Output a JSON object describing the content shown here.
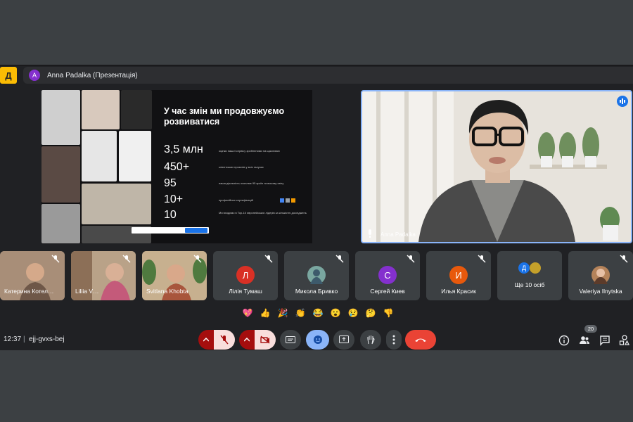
{
  "header": {
    "logo_letter": "Д",
    "presenter_initial": "A",
    "presenter_title": "Anna Padalka (Презентація)"
  },
  "slide": {
    "title": "У час змін ми продовжуємо розвиватися",
    "stats": [
      {
        "value": "3,5 млн",
        "desc": "оцінки нашої сервісу зробленими на щасливих"
      },
      {
        "value": "450+",
        "desc": "клієнтських проєктів у всіх галузях"
      },
      {
        "value": "95",
        "desc": "наша діяльність охоплює 95 країн та всьому світу"
      },
      {
        "value": "10+",
        "desc": "професійних сертифікацій"
      },
      {
        "value": "10",
        "desc": "Ми входимо в Top-10 європейських лідерів за кількістю досліджень"
      }
    ]
  },
  "speaker": {
    "name": "Anna Padalka"
  },
  "tiles": [
    {
      "name": "Катерина Котел…",
      "type": "photo"
    },
    {
      "name": "Liliia V…",
      "type": "photo"
    },
    {
      "name": "Svitlana Khobta",
      "type": "photo"
    },
    {
      "name": "Лілія Тумаш",
      "type": "avatar",
      "initial": "Л",
      "color": "#d93025"
    },
    {
      "name": "Микола Бривко",
      "type": "avatar",
      "initial": "",
      "color": "#7aa7a0"
    },
    {
      "name": "Сергей Киев",
      "type": "avatar",
      "initial": "С",
      "color": "#8430ce"
    },
    {
      "name": "Илья Красик",
      "type": "avatar",
      "initial": "И",
      "color": "#e8590c"
    },
    {
      "name": "Ще 10 осіб",
      "type": "more",
      "initial": "Д",
      "color": "#1a73e8"
    },
    {
      "name": "Valeriya Ilnytska",
      "type": "avatar",
      "initial": "",
      "color": "#b5835a"
    }
  ],
  "reactions": [
    "💖",
    "👍",
    "🎉",
    "👏",
    "😂",
    "😮",
    "😢",
    "🤔",
    "👎"
  ],
  "footer": {
    "time": "12:37",
    "separator": "|",
    "meeting_code": "ejj-gvxs-bej",
    "participants_count": "20"
  }
}
